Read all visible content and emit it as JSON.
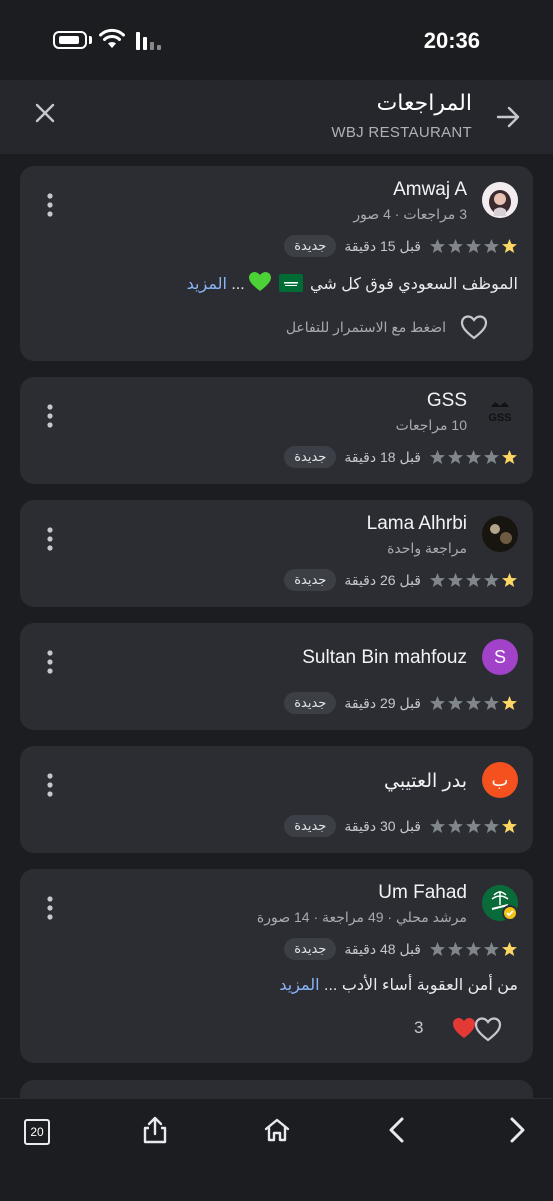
{
  "status": {
    "time": "20:36"
  },
  "header": {
    "title": "المراجعات",
    "subtitle": "WBJ RESTAURANT"
  },
  "colors": {
    "star_filled": "#fdd663",
    "star_empty": "#80868b",
    "link": "#8ab4f8",
    "heart_red": "#e53935"
  },
  "reviews": [
    {
      "name": "Amwaj A",
      "meta": "3 مراجعات · 4 صور",
      "rating": 1,
      "time": "قبل 15 دقيقة",
      "badge": "جديدة",
      "text": "الموظف السعودي فوق كل شي",
      "more": "المزيد",
      "ellipsis": "...",
      "like_hint": "اضغط مع الاستمرار للتفاعل"
    },
    {
      "name": "GSS",
      "meta": "10 مراجعات",
      "rating": 1,
      "time": "قبل 18 دقيقة",
      "badge": "جديدة",
      "avatar_text": "GSS"
    },
    {
      "name": "Lama Alhrbi",
      "meta": "مراجعة واحدة",
      "rating": 1,
      "time": "قبل 26 دقيقة",
      "badge": "جديدة"
    },
    {
      "name": "Sultan Bin mahfouz",
      "avatar_letter": "S",
      "avatar_color": "#a142c9",
      "rating": 1,
      "time": "قبل 29 دقيقة",
      "badge": "جديدة"
    },
    {
      "name": "بدر العتيبي",
      "avatar_letter": "ب",
      "avatar_color": "#f4511e",
      "rating": 1,
      "time": "قبل 30 دقيقة",
      "badge": "جديدة"
    },
    {
      "name": "Um Fahad",
      "meta": "مرشد محلي · 49 مراجعة · 14 صورة",
      "rating": 1,
      "time": "قبل 48 دقيقة",
      "badge": "جديدة",
      "text": "من أمن العقوبة أساء الأدب",
      "more": "المزيد",
      "ellipsis": "...",
      "reaction_count": "3"
    }
  ],
  "bottom_bar": {
    "tab_count": "20"
  }
}
